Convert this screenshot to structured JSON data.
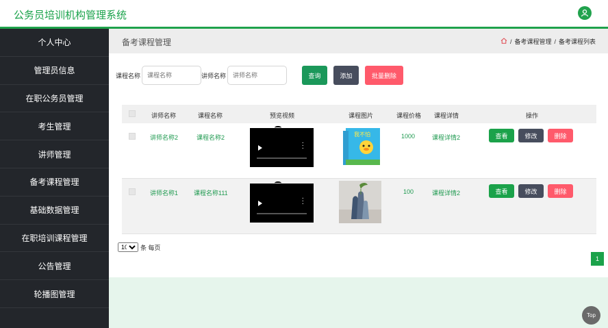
{
  "app": {
    "title": "公务员培训机构管理系统"
  },
  "sidebar": {
    "items": [
      {
        "label": "个人中心"
      },
      {
        "label": "管理员信息"
      },
      {
        "label": "在职公务员管理"
      },
      {
        "label": "考生管理"
      },
      {
        "label": "讲师管理"
      },
      {
        "label": "备考课程管理"
      },
      {
        "label": "基础数据管理"
      },
      {
        "label": "在职培训课程管理"
      },
      {
        "label": "公告管理"
      },
      {
        "label": "轮播图管理"
      }
    ]
  },
  "header": {
    "page_title": "备考课程管理",
    "breadcrumb": [
      "备考课程管理",
      "备考课程列表"
    ]
  },
  "search": {
    "course_label": "课程名称",
    "course_placeholder": "课程名称",
    "teacher_label": "讲师名称",
    "teacher_placeholder": "讲师名称",
    "query_label": "查询",
    "add_label": "添加",
    "batch_delete_label": "批量删除"
  },
  "table": {
    "columns": [
      "讲师名称",
      "课程名称",
      "预览视频",
      "课程图片",
      "课程价格",
      "课程详情",
      "操作"
    ],
    "rows": [
      {
        "teacher": "讲师名称2",
        "course": "课程名称2",
        "price": "1000",
        "detail": "课程详情2"
      },
      {
        "teacher": "讲师名称1",
        "course": "课程名称111",
        "price": "100",
        "detail": "课程详情2"
      }
    ],
    "action_view": "查看",
    "action_edit": "修改",
    "action_delete": "删除"
  },
  "pager": {
    "page_size": "10",
    "per_page_label": "条 每页",
    "current_page": "1"
  },
  "top_button": "Top",
  "colors": {
    "accent": "#1fa24b",
    "sidebar": "#23262b",
    "danger": "#ff5a6b"
  }
}
